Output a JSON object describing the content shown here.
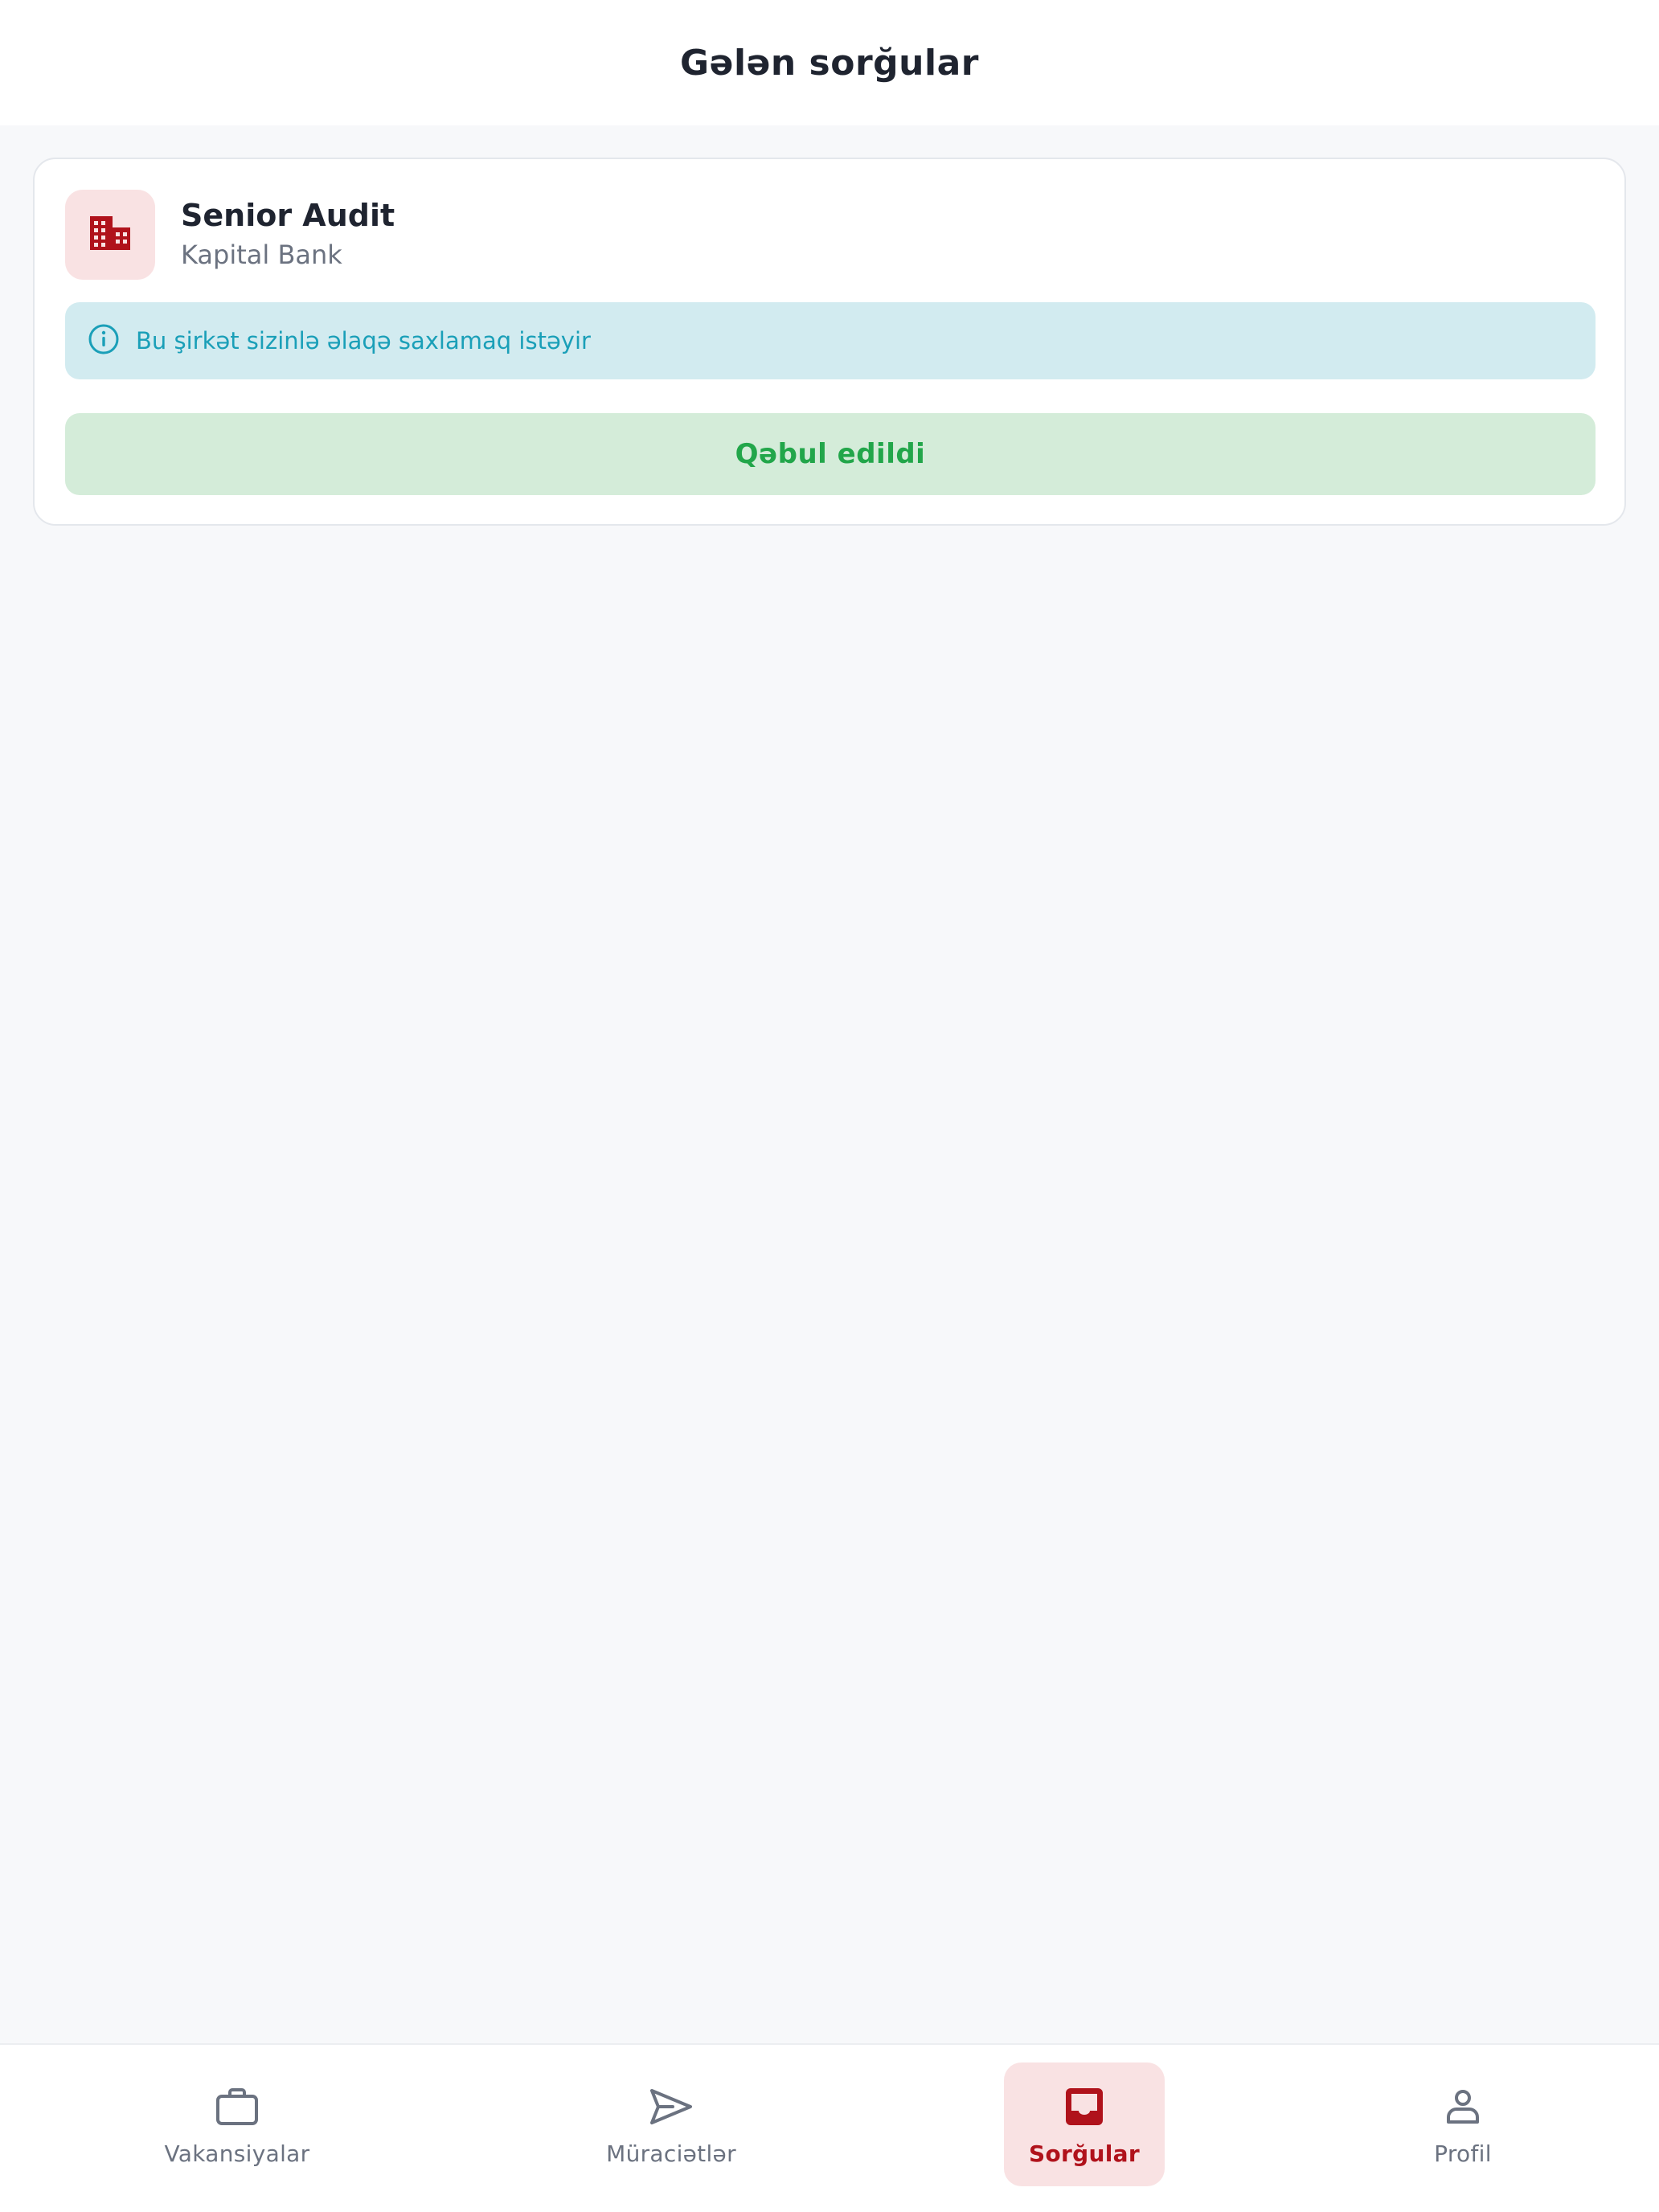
{
  "header": {
    "title": "Gələn sorğular"
  },
  "request_card": {
    "job_title": "Senior Audit",
    "company": "Kapital Bank",
    "logo_icon": "building-icon",
    "info_icon": "info-icon",
    "info_message": "Bu şirkət sizinlə əlaqə saxlamaq istəyir",
    "status_label": "Qəbul edildi"
  },
  "bottom_nav": {
    "items": [
      {
        "label": "Vakansiyalar",
        "icon": "briefcase-icon",
        "active": false
      },
      {
        "label": "Müraciətlər",
        "icon": "send-icon",
        "active": false
      },
      {
        "label": "Sorğular",
        "icon": "inbox-icon",
        "active": true
      },
      {
        "label": "Profil",
        "icon": "user-icon",
        "active": false
      }
    ]
  },
  "colors": {
    "accent": "#b0121b",
    "accent_bg": "#f9e2e3",
    "info_text": "#1a9fb8",
    "info_bg": "#d2ebf0",
    "success_text": "#22a64a",
    "success_bg": "#d4ecd9"
  }
}
